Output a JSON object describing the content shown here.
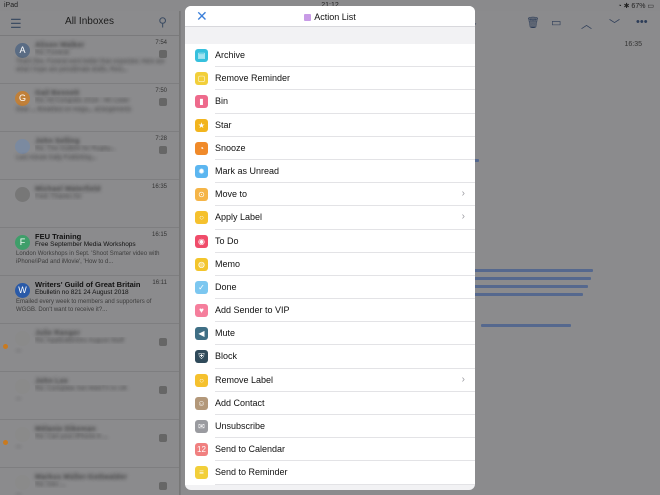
{
  "status": {
    "device": "iPad",
    "time": "21:12",
    "battery": "67%"
  },
  "inbox": {
    "title": "All Inboxes",
    "messages": [
      {
        "avatar": "A",
        "color": "#5a6c84",
        "sender": "Alison Walker",
        "time": "7:54",
        "subject": "Re: Funeral",
        "preview": "That's fine. Funeral went better than expected. Here are what I hope are penultimate drafts. Rest...",
        "blur": true,
        "badge": true
      },
      {
        "avatar": "G",
        "color": "#c0803a",
        "sender": "Gail Bennett",
        "time": "7:50",
        "subject": "Re: All Congrats 2018 - Mr Lister",
        "preview": "Dear ... Breakfast on mega... arrangements",
        "blur": true,
        "badge": true
      },
      {
        "avatar": "",
        "color": "#7b8aa0",
        "sender": "John Selling",
        "time": "7:28",
        "subject": "Re: The Outline for Rugby...",
        "preview": "Last minute Daily Publishing...",
        "blur": true,
        "badge": true
      },
      {
        "avatar": "",
        "color": "#777",
        "sender": "Michael Waterfield",
        "time": "16:35",
        "subject": "Fwd: Thanks for",
        "preview": "",
        "blur": true,
        "badge": false
      },
      {
        "avatar": "F",
        "color": "#3f9e6a",
        "sender": "FEU Training",
        "time": "16:15",
        "subject": "Free September Media Workshops",
        "preview": "London Workshops in Sept. 'Shoot Smarter video with iPhone/iPad and iMovie', 'How to d...",
        "blur": false,
        "badge": false
      },
      {
        "avatar": "W",
        "color": "#2a5aa8",
        "sender": "Writers' Guild of Great Britain",
        "time": "16:11",
        "subject": "Ebulletin no 821 24 August 2018",
        "preview": "Emailed every week to members and supporters of WGGB. Don't want to receive it?...",
        "blur": false,
        "badge": false
      },
      {
        "avatar": "",
        "color": "#8a8a8a",
        "sender": "Julie Ranger",
        "time": "",
        "subject": "Re: ApplicationInc August Stuff",
        "preview": "...",
        "blur": true,
        "badge": true,
        "dot": true
      },
      {
        "avatar": "",
        "color": "#8a8a8a",
        "sender": "John Lee",
        "time": "",
        "subject": "Re: Complete Set WebTV in UK",
        "preview": "...",
        "blur": true,
        "badge": true
      },
      {
        "avatar": "",
        "color": "#8a8a8a",
        "sender": "Mélanie Dikeman",
        "time": "",
        "subject": "Re: Can your iPhone 8 ...",
        "preview": "...",
        "blur": true,
        "badge": true,
        "dot": true
      },
      {
        "avatar": "",
        "color": "#8a8a8a",
        "sender": "Markus Müller-Gottwalder",
        "time": "",
        "subject": "Re: Dev ...",
        "preview": "...",
        "blur": true,
        "badge": true
      }
    ]
  },
  "reader": {
    "time": "16:35"
  },
  "sheet": {
    "title": "Action List",
    "close_icon": "close-icon",
    "items": [
      {
        "label": "Archive",
        "icon": "archive-icon",
        "color": "#36c0dd",
        "glyph": "▤",
        "chevron": false
      },
      {
        "label": "Remove Reminder",
        "icon": "remove-reminder-icon",
        "color": "#f2cf3a",
        "glyph": "▢",
        "chevron": false
      },
      {
        "label": "Bin",
        "icon": "bin-icon",
        "color": "#ee6a8c",
        "glyph": "▮",
        "chevron": false
      },
      {
        "label": "Star",
        "icon": "star-icon",
        "color": "#f2b51e",
        "glyph": "★",
        "chevron": false
      },
      {
        "label": "Snooze",
        "icon": "snooze-icon",
        "color": "#f08a2a",
        "glyph": "◔",
        "chevron": false
      },
      {
        "label": "Mark as Unread",
        "icon": "mark-unread-icon",
        "color": "#5cb6f0",
        "glyph": "✹",
        "chevron": false
      },
      {
        "label": "Move to",
        "icon": "move-to-icon",
        "color": "#f5b548",
        "glyph": "⊙",
        "chevron": true
      },
      {
        "label": "Apply Label",
        "icon": "apply-label-icon",
        "color": "#f5c12e",
        "glyph": "○",
        "chevron": true
      },
      {
        "label": "To Do",
        "icon": "to-do-icon",
        "color": "#f04c6a",
        "glyph": "◉",
        "chevron": false
      },
      {
        "label": "Memo",
        "icon": "memo-icon",
        "color": "#f3c52c",
        "glyph": "◍",
        "chevron": false
      },
      {
        "label": "Done",
        "icon": "done-icon",
        "color": "#7cc7f0",
        "glyph": "✓",
        "chevron": false
      },
      {
        "label": "Add Sender to VIP",
        "icon": "vip-heart-icon",
        "color": "#f57e9c",
        "glyph": "♥",
        "chevron": false
      },
      {
        "label": "Mute",
        "icon": "mute-icon",
        "color": "#3f6f85",
        "glyph": "◀",
        "chevron": false
      },
      {
        "label": "Block",
        "icon": "block-icon",
        "color": "#2f4a5a",
        "glyph": "⛨",
        "chevron": false
      },
      {
        "label": "Remove Label",
        "icon": "remove-label-icon",
        "color": "#f5c12e",
        "glyph": "○",
        "chevron": true
      },
      {
        "label": "Add Contact",
        "icon": "add-contact-icon",
        "color": "#b3987a",
        "glyph": "☺",
        "chevron": false
      },
      {
        "label": "Unsubscribe",
        "icon": "unsubscribe-icon",
        "color": "#9a9ba0",
        "glyph": "✉",
        "chevron": false
      },
      {
        "label": "Send to Calendar",
        "icon": "calendar-icon",
        "color": "#f08080",
        "glyph": "12",
        "chevron": false
      },
      {
        "label": "Send to Reminder",
        "icon": "reminder-icon",
        "color": "#f2cf3a",
        "glyph": "≡",
        "chevron": false
      }
    ]
  }
}
